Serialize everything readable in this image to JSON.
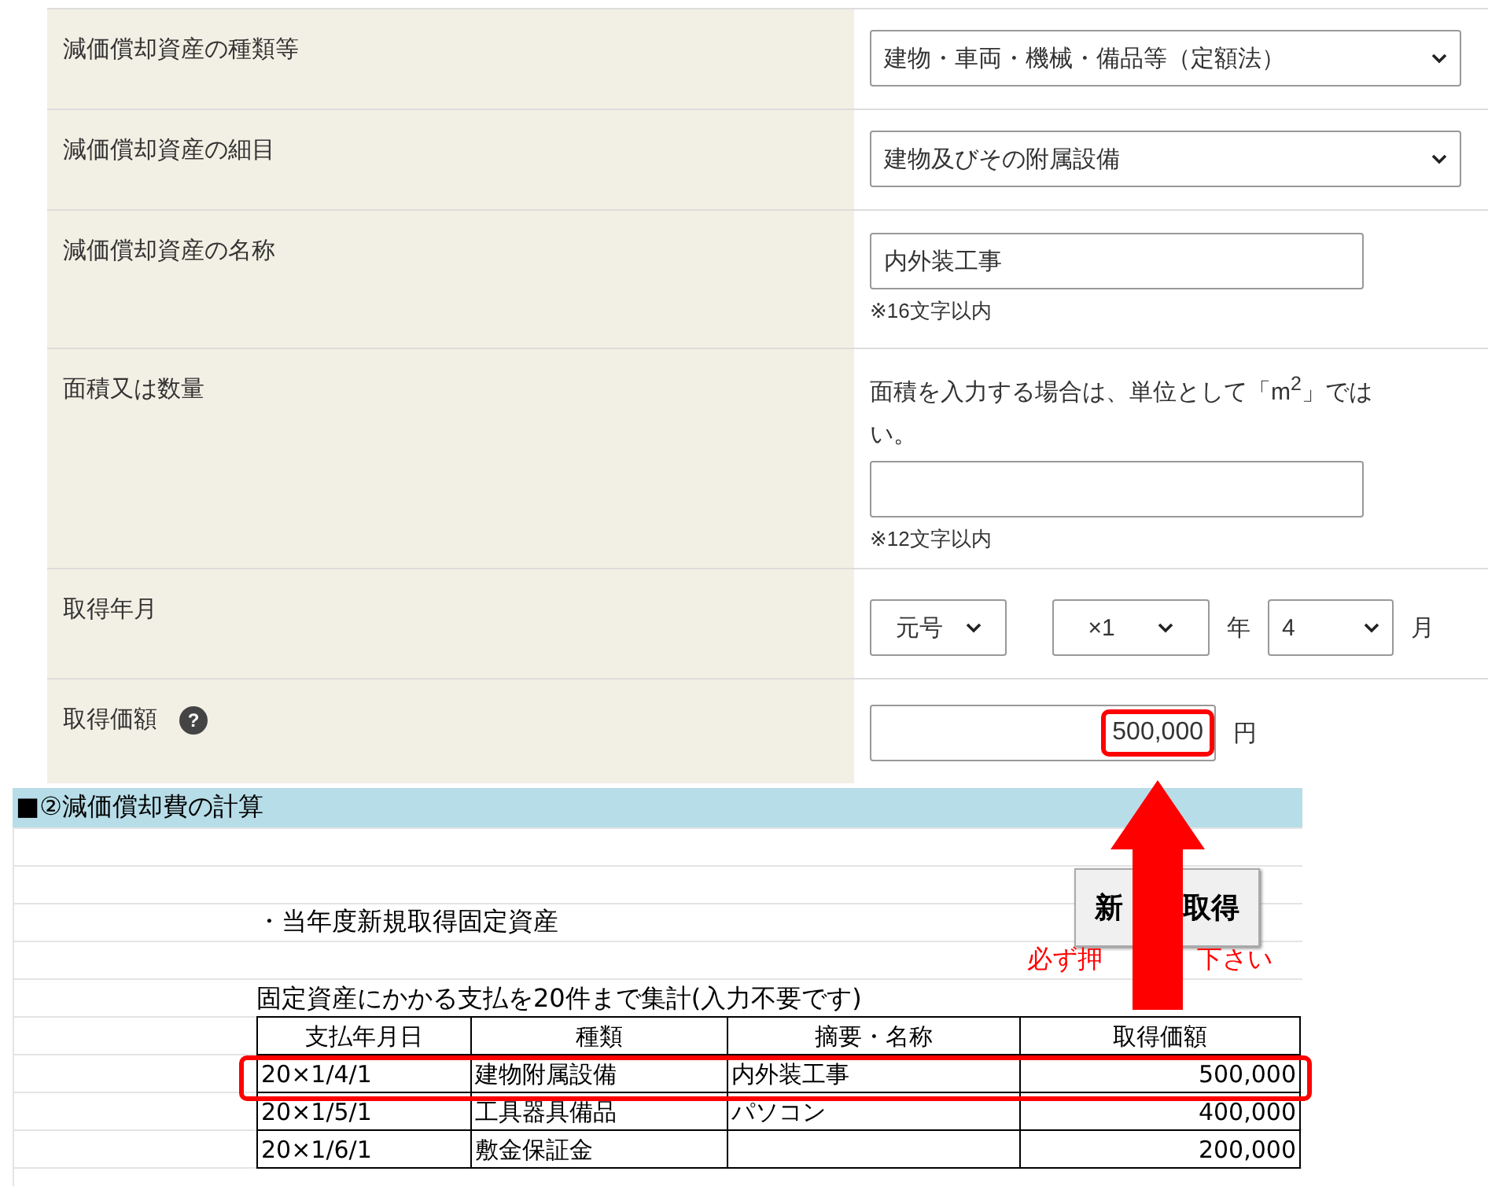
{
  "form": {
    "rows": [
      {
        "kind": "select",
        "label": "減価償却資産の種類等",
        "value": "建物・車両・機械・備品等（定額法）"
      },
      {
        "kind": "select",
        "label": "減価償却資産の細目",
        "value": "建物及びその附属設備"
      },
      {
        "kind": "text",
        "label": "減価償却資産の名称",
        "value": "内外装工事",
        "note": "※16文字以内"
      },
      {
        "kind": "hinted",
        "label": "面積又は数量",
        "hint_lines": [
          "面積を入力する場合は、単位として「m$^{2}$」では",
          "い。"
        ],
        "note": "※12文字以内"
      },
      {
        "kind": "date",
        "label": "取得年月",
        "era": "元号",
        "year": "×1",
        "year_unit": "年",
        "month": "4",
        "month_unit": "月"
      },
      {
        "kind": "amount",
        "label": "取得価額",
        "help": "?",
        "value": "500,000",
        "unit": "円",
        "highlighted": true
      }
    ]
  },
  "sheet": {
    "title": "■②減価償却費の計算",
    "subtitle": "・当年度新規取得固定資産",
    "button_parts": [
      "新",
      "取得"
    ],
    "note_parts": [
      "必ず押",
      "下さい"
    ],
    "caption": "固定資産にかかる支払を20件まで集計(入力不要です)",
    "columns": [
      "支払年月日",
      "種類",
      "摘要・名称",
      "取得価額"
    ],
    "rows": [
      {
        "date": "20×1/4/1",
        "type": "建物附属設備",
        "name": "内外装工事",
        "amount": "500,000",
        "highlighted": true
      },
      {
        "date": "20×1/5/1",
        "type": "工具器具備品",
        "name": "パソコン",
        "amount": "400,000",
        "highlighted": false
      },
      {
        "date": "20×1/6/1",
        "type": "敷金保証金",
        "amount": "200,000",
        "highlighted": false
      }
    ]
  }
}
